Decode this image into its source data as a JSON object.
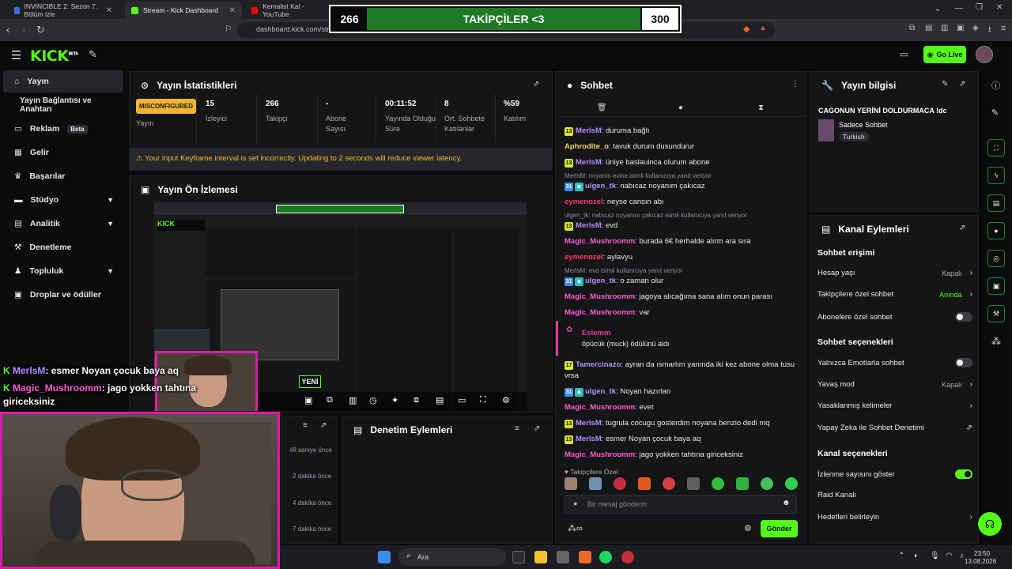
{
  "browser": {
    "tabs": [
      {
        "label": "INVINCIBLE 2. Sezon 7. Bölüm izle",
        "active": false
      },
      {
        "label": "Stream - Kick Dashboard",
        "active": true
      },
      {
        "label": "Kemalist Kal - YouTube",
        "active": false
      }
    ],
    "url": "dashboard.kick.com/str"
  },
  "overlay": {
    "left": "266",
    "center": "TAKİPÇİLER <3",
    "right": "300",
    "progress": 0.887
  },
  "topbar": {
    "logo": "KICK",
    "logo_sup": "BETA",
    "go_live": "Go Live"
  },
  "sidebar": {
    "items": [
      {
        "label": "Yayın",
        "icon": "home-icon",
        "active": true
      },
      {
        "label": "Yayın Bağlantısı ve Anahtarı",
        "icon": "",
        "active": false
      },
      {
        "label": "Reklam",
        "icon": "ad-icon",
        "badge": "Beta"
      },
      {
        "label": "Gelir",
        "icon": "chart-icon"
      },
      {
        "label": "Başarılar",
        "icon": "trophy-icon"
      },
      {
        "label": "Stüdyo",
        "icon": "studio-icon",
        "chevron": true
      },
      {
        "label": "Analitik",
        "icon": "analytics-icon",
        "chevron": true
      },
      {
        "label": "Denetleme",
        "icon": "hammer-icon"
      },
      {
        "label": "Topluluk",
        "icon": "community-icon",
        "chevron": true
      },
      {
        "label": "Droplar ve ödüller",
        "icon": "gift-icon"
      }
    ]
  },
  "stats": {
    "title": "Yayın İstatistikleri",
    "status_badge": "MISCONFIGURED",
    "status_label": "Yayın",
    "items": [
      {
        "value": "15",
        "label": "İzleyici"
      },
      {
        "value": "266",
        "label": "Takipçi"
      },
      {
        "value": "-",
        "label": "Abone Sayısı"
      },
      {
        "value": "00:11:52",
        "label": "Yayında Olduğu Süre"
      },
      {
        "value": "8",
        "label": "Ort. Sohbete Katılanlar"
      },
      {
        "value": "%59",
        "label": "Katılım"
      }
    ],
    "warning": "Your input Keyframe interval is set incorrectly. Updating to 2 seconds will reduce viewer latency."
  },
  "preview": {
    "title": "Yayın Ön İzlemesi",
    "new_badge": "YENİ"
  },
  "moderation": {
    "title": "Denetim Eylemleri",
    "times": [
      "48 saniye önce",
      "2 dakika önce",
      "4 dakika önce",
      "7 dakika önce"
    ]
  },
  "chat": {
    "title": "Sohbet",
    "messages": [
      {
        "badge": "13",
        "user": "MerlsM",
        "color": "#b58cff",
        "text": "duruma bağlı"
      },
      {
        "badge": "",
        "user": "Aphrodite_o",
        "color": "#f2d45c",
        "text": "tavuk durum dusundurur"
      },
      {
        "badge": "13",
        "user": "MerlsM",
        "color": "#b58cff",
        "text": "üniye baslauinca olurum abone"
      },
      {
        "reply": "MerlsM: noyanin evine isimli kullanıcıya yanıt veriyor"
      },
      {
        "badge": "31",
        "user": "ulgen_tk",
        "color": "#b58cff",
        "text": "nabıcaz noyanım çakıcaz",
        "double": true
      },
      {
        "badge": "",
        "user": "eymenozel",
        "color": "#ff3b5c",
        "text": "neyse cansın abı"
      },
      {
        "reply": "ulgen_tk: nabıcaz noyanım çakıcaz isimli kullanıcıya yanıt veriyor"
      },
      {
        "badge": "13",
        "user": "MerlsM",
        "color": "#b58cff",
        "text": "evd"
      },
      {
        "badge": "",
        "user": "Magic_Mushroomm",
        "color": "#ff5ad1",
        "text": "burada 6€ herhalde alırm ara sıra"
      },
      {
        "badge": "",
        "user": "eymenozel",
        "color": "#ff3b5c",
        "text": "aylavyu"
      },
      {
        "reply": "MerlsM: evd isimli kullanıcıya yanıt veriyor"
      },
      {
        "badge": "31",
        "user": "ulgen_tk",
        "color": "#b58cff",
        "text": "o zaman olur",
        "double": true
      },
      {
        "badge": "",
        "user": "Magic_Mushroomm",
        "color": "#ff5ad1",
        "text": "jagoya alıcağıma sana alım onun parası"
      },
      {
        "badge": "",
        "user": "Magic_Mushroomm",
        "color": "#ff5ad1",
        "text": "var"
      }
    ],
    "reward": {
      "user": "Eslemm",
      "text": "öpücük (muck) ödülünü aldı"
    },
    "messages2": [
      {
        "badge": "17",
        "user": "Tamercinazo",
        "color": "#b58cff",
        "text": "ayran da ısmarlım yanında iki kez abone olma tusu",
        "cont": "vrsa"
      },
      {
        "badge": "31",
        "user": "ulgen_tk",
        "color": "#b58cff",
        "text": "Noyan hazırlan",
        "double": true
      },
      {
        "badge": "",
        "user": "Magic_Mushroomm",
        "color": "#ff5ad1",
        "text": "evet"
      },
      {
        "badge": "13",
        "user": "MerlsM",
        "color": "#b58cff",
        "text": "tugrula cocugu gosterdim noyana benzio dedi mq"
      },
      {
        "badge": "13",
        "user": "MerlsM",
        "color": "#b58cff",
        "text": "esmer Noyan çocuk baya aq"
      },
      {
        "badge": "",
        "user": "Magic_Mushroomm",
        "color": "#ff5ad1",
        "text": "jago yokken tahtına giriceksiniz"
      }
    ],
    "followers_only": "Takipçilere Özel",
    "input_placeholder": "Bir mesaj gönderin",
    "send": "Gönder"
  },
  "stream_info": {
    "title": "Yayın bilgisi",
    "stream_title": "CAGONUN YERİNİ DOLDURMACA !dc",
    "category": "Sadece Sohbet",
    "language": "Turkish"
  },
  "channel_actions": {
    "title": "Kanal Eylemleri",
    "chat_access_head": "Sohbet erişimi",
    "account_age": {
      "label": "Hesap yaşı",
      "value": "Kapalı"
    },
    "followers_chat": {
      "label": "Takipçilere özel sohbet",
      "value": "Anında"
    },
    "subs_chat": {
      "label": "Abonelere özel sohbet"
    },
    "chat_options_head": "Sohbet seçenekleri",
    "emote_only": {
      "label": "Yalnızca Emotlarla sohbet"
    },
    "slow_mode": {
      "label": "Yavaş mod",
      "value": "Kapalı"
    },
    "banned_words": {
      "label": "Yasaklanmış kelimeler"
    },
    "ai_moderation": {
      "label": "Yapay Zeka ile Sohbet Denetimi"
    },
    "channel_options_head": "Kanal seçenekleri",
    "show_viewers": {
      "label": "İzlenme sayısını göster"
    },
    "raid": {
      "label": "Raid Kanalı"
    },
    "goals": {
      "label": "Hedefleri belirleyin"
    }
  },
  "overlay_chat": [
    {
      "user": "MerlsM",
      "text": ": esmer Noyan çocuk baya aq"
    },
    {
      "user": "Magic_Mushroomm",
      "text": ": jago yokken tahtına"
    },
    {
      "user": "",
      "text": "giriceksiniz"
    }
  ],
  "taskbar": {
    "search": "Ara",
    "time": "23:50",
    "date": "13.08.2026"
  }
}
